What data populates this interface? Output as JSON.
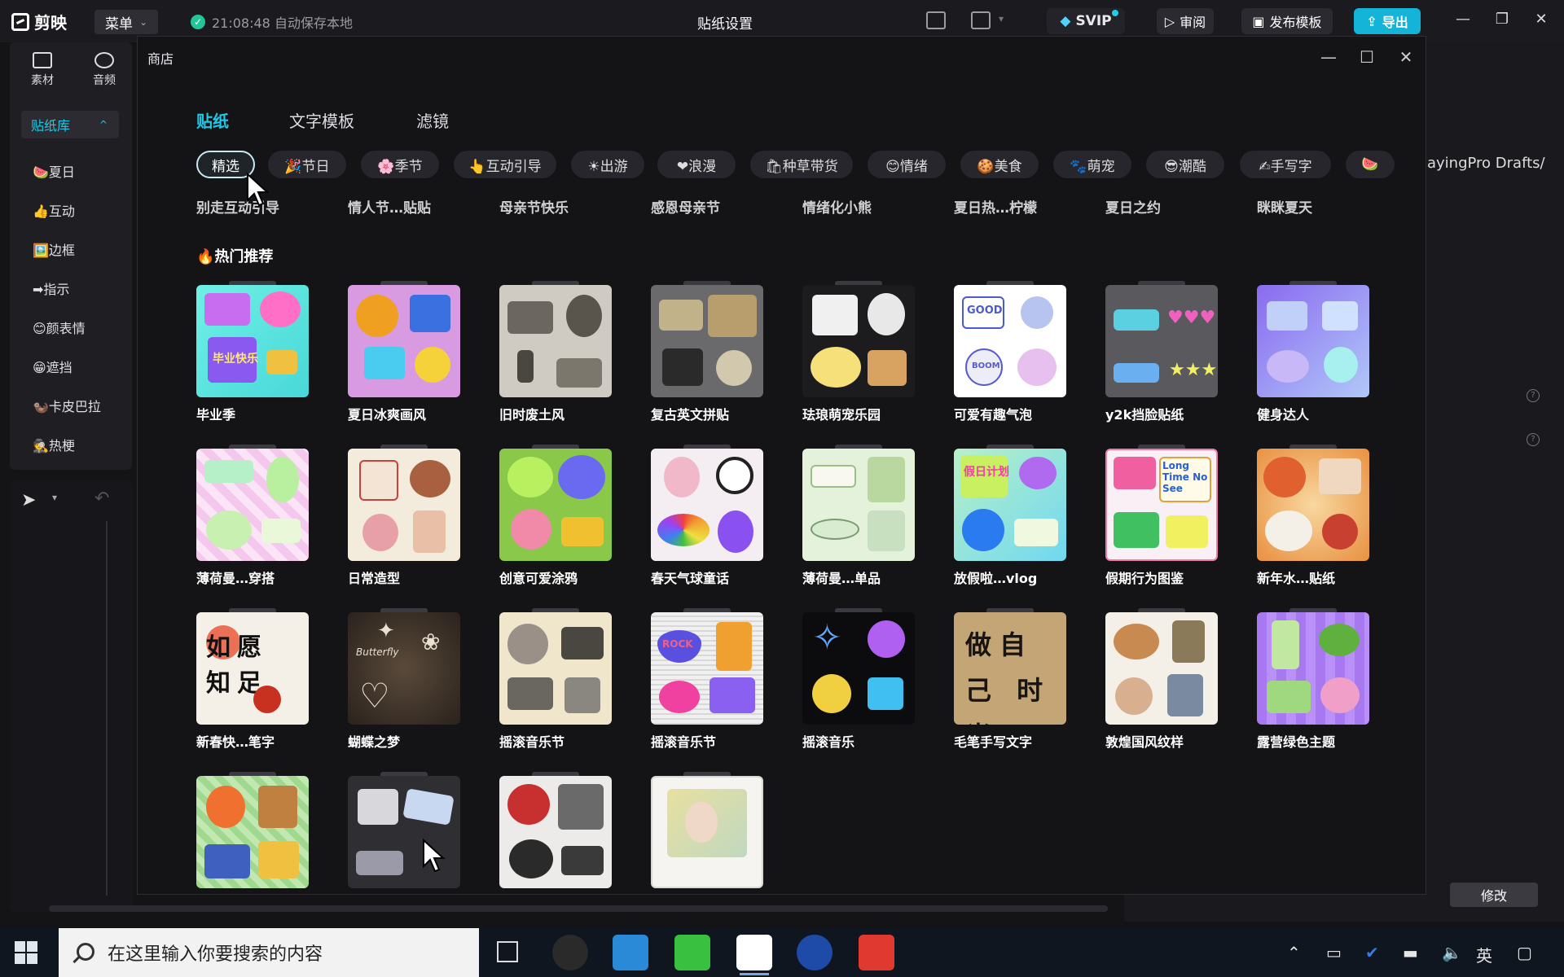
{
  "app": {
    "logo_text": "剪映",
    "menu_label": "菜单",
    "autosave": "21:08:48 自动保存本地",
    "doc_title": "贴纸设置",
    "svip_label": "SVIP",
    "review_label": "审阅",
    "publish_label": "发布模板",
    "export_label": "导出"
  },
  "left_panel": {
    "tabs": [
      {
        "label": "素材",
        "icon": "media-icon"
      },
      {
        "label": "音频",
        "icon": "audio-icon"
      }
    ],
    "library_label": "贴纸库",
    "items": [
      "🍉夏日",
      "👍互动",
      "🖼️边框",
      "➡指示",
      "😊颜表情",
      "😁遮挡",
      "🦦卡皮巴拉",
      "🕵️热梗"
    ]
  },
  "right_panel": {
    "path_text": "ayingPro Drafts/",
    "modify_label": "修改"
  },
  "store": {
    "title": "商店",
    "category_tabs": [
      "贴纸",
      "文字模板",
      "滤镜"
    ],
    "chips": [
      "精选",
      "🎉节日",
      "🌸季节",
      "👆互动引导",
      "☀出游",
      "❤浪漫",
      "🛍种草带货",
      "😊情绪",
      "🍪美食",
      "🐾萌宠",
      "😎潮酷",
      "✍手写字"
    ],
    "cut_row": [
      "别走互动引导",
      "情人节…贴贴",
      "母亲节快乐",
      "感恩母亲节",
      "情绪化小熊",
      "夏日热…柠檬",
      "夏日之约",
      "眯眯夏天"
    ],
    "hot_title": "🔥热门推荐",
    "packs": [
      {
        "label": "毕业季"
      },
      {
        "label": "夏日冰爽画风"
      },
      {
        "label": "旧时废土风"
      },
      {
        "label": "复古英文拼贴"
      },
      {
        "label": "珐琅萌宠乐园"
      },
      {
        "label": "可爱有趣气泡"
      },
      {
        "label": "y2k挡脸贴纸"
      },
      {
        "label": "健身达人"
      },
      {
        "label": "薄荷曼…穿搭"
      },
      {
        "label": "日常造型"
      },
      {
        "label": "创意可爱涂鸦"
      },
      {
        "label": "春天气球童话"
      },
      {
        "label": "薄荷曼…单品"
      },
      {
        "label": "放假啦…vlog"
      },
      {
        "label": "假期行为图鉴"
      },
      {
        "label": "新年水…贴纸"
      },
      {
        "label": "新春快…笔字"
      },
      {
        "label": "蝴蝶之梦"
      },
      {
        "label": "摇滚音乐节"
      },
      {
        "label": "摇滚音乐节"
      },
      {
        "label": "摇滚音乐"
      },
      {
        "label": "毛笔手写文字"
      },
      {
        "label": "敦煌国风纹样"
      },
      {
        "label": "露营绿色主题"
      },
      {
        "label": ""
      },
      {
        "label": ""
      },
      {
        "label": ""
      },
      {
        "label": ""
      }
    ],
    "thumb_texts": {
      "graduation": "毕业快乐",
      "good": "GOOD",
      "boom": "BOOM",
      "rock": "ROCK",
      "butterfly": "Butterfly",
      "holiday": "假日计划",
      "longtime": "Long Time No See",
      "calligraphy": "如愿 知足",
      "brush": "做自己 时光"
    }
  },
  "taskbar": {
    "search_placeholder": "在这里输入你要搜索的内容",
    "ime_label": "英"
  },
  "colors": {
    "accent": "#1fc8e6",
    "export_bg": "#14b4d8",
    "background": "#141416"
  }
}
